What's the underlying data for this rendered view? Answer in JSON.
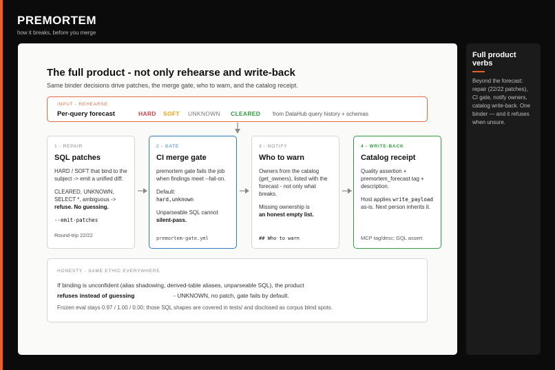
{
  "brand": {
    "title": "PREMORTEM",
    "subtitle": "how it breaks, before you merge"
  },
  "slide": {
    "title": "The full product - not only rehearse and write-back",
    "subtitle": "Same binder decisions drive patches, the merge gate, who to warn, and the catalog receipt."
  },
  "input": {
    "tag": "INPUT - REHEARSE",
    "name": "Per-query forecast",
    "chips": {
      "hard": "HARD",
      "soft": "SOFT",
      "unknown": "UNKNOWN",
      "cleared": "CLEARED"
    },
    "source": "from DataHub query history + schemas"
  },
  "cards": {
    "repair": {
      "tag": "1 - REPAIR",
      "title": "SQL patches",
      "p1": "HARD / SOFT that bind to the subject -> emit a unified diff.",
      "p2_plain": "CLEARED, UNKNOWN, SELECT *, ambiguous ->",
      "p2_bold": "refuse. No guessing.",
      "code": "--emit-patches",
      "foot": "Round-trip 22/22"
    },
    "gate": {
      "tag": "2 - GATE",
      "title": "CI merge gate",
      "p1": "premortem gate fails the job when findings meet --fail-on.",
      "p2_label": "Default:",
      "p2_code": "hard,unknown",
      "p3_plain": "Unparseable SQL cannot",
      "p3_bold": "silent-pass.",
      "foot": "premortem-gate.yml"
    },
    "notify": {
      "tag": "3 - NOTIFY",
      "title": "Who to warn",
      "p1": "Owners from the catalog (get_owners), listed with the forecast - not only what breaks.",
      "p2_plain": "Missing ownership is",
      "p2_bold": "an honest empty list.",
      "foot": "## Who to warn"
    },
    "writeback": {
      "tag": "4 - WRITE-BACK",
      "title": "Catalog receipt",
      "p1": "Quality assertion + premortem_forecast tag + description.",
      "p2_plain1": "Host applies",
      "p2_code": "write_payload",
      "p2_plain2": "as-is. Next person inherits it.",
      "foot": "MCP tag/desc; GQL assert"
    }
  },
  "honesty": {
    "tag": "HONESTY - SAME ETHIC EVERYWHERE",
    "line1": "If binding is unconfident (alias shadowing, derived-table aliases, unparseable SQL), the product",
    "bold": "refuses instead of guessing",
    "rest": "- UNKNOWN, no patch, gate fails by default.",
    "line3": "Frozen eval stays 0.97 / 1.00 / 0.00; those SQL shapes are covered in tests/ and disclosed as corpus blind spots."
  },
  "sidebar": {
    "title": "Full product verbs",
    "text": "Beyond the forecast: repair (22/22 patches), CI gate, notify owners, catalog write-back. One binder — and it refuses when unsure."
  },
  "colors": {
    "accent": "#e8602c",
    "hard": "#d6404a",
    "soft": "#e8a319",
    "cleared": "#2e9c3f",
    "gate_blue": "#2f79c4"
  }
}
